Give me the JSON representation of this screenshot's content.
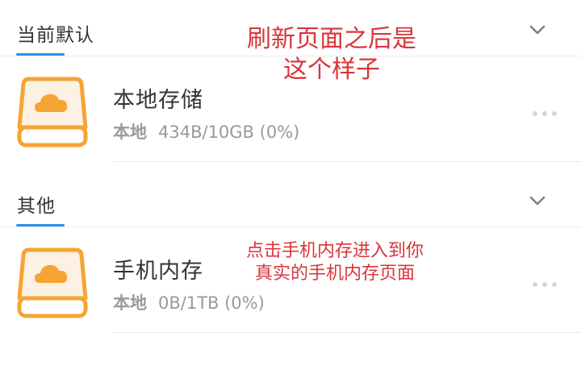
{
  "sections": [
    {
      "title": "当前默认",
      "storage": {
        "name": "本地存储",
        "type": "本地",
        "usage": "434B/10GB (0%)"
      }
    },
    {
      "title": "其他",
      "storage": {
        "name": "手机内存",
        "type": "本地",
        "usage": "0B/1TB (0%)"
      }
    }
  ],
  "annotations": {
    "refresh_note": [
      "刷新页面之后是",
      "这个样子"
    ],
    "phone_note": [
      "点击手机内存进入到你",
      "真实的手机内存页面"
    ]
  },
  "icons": {
    "drive": "cloud-drive-icon",
    "collapse": "chevron-down-icon",
    "more": "more-dots-icon"
  },
  "colors": {
    "accent": "#2f8ef0",
    "drive_icon": "#f5a533",
    "annotation": "#d9343b"
  }
}
